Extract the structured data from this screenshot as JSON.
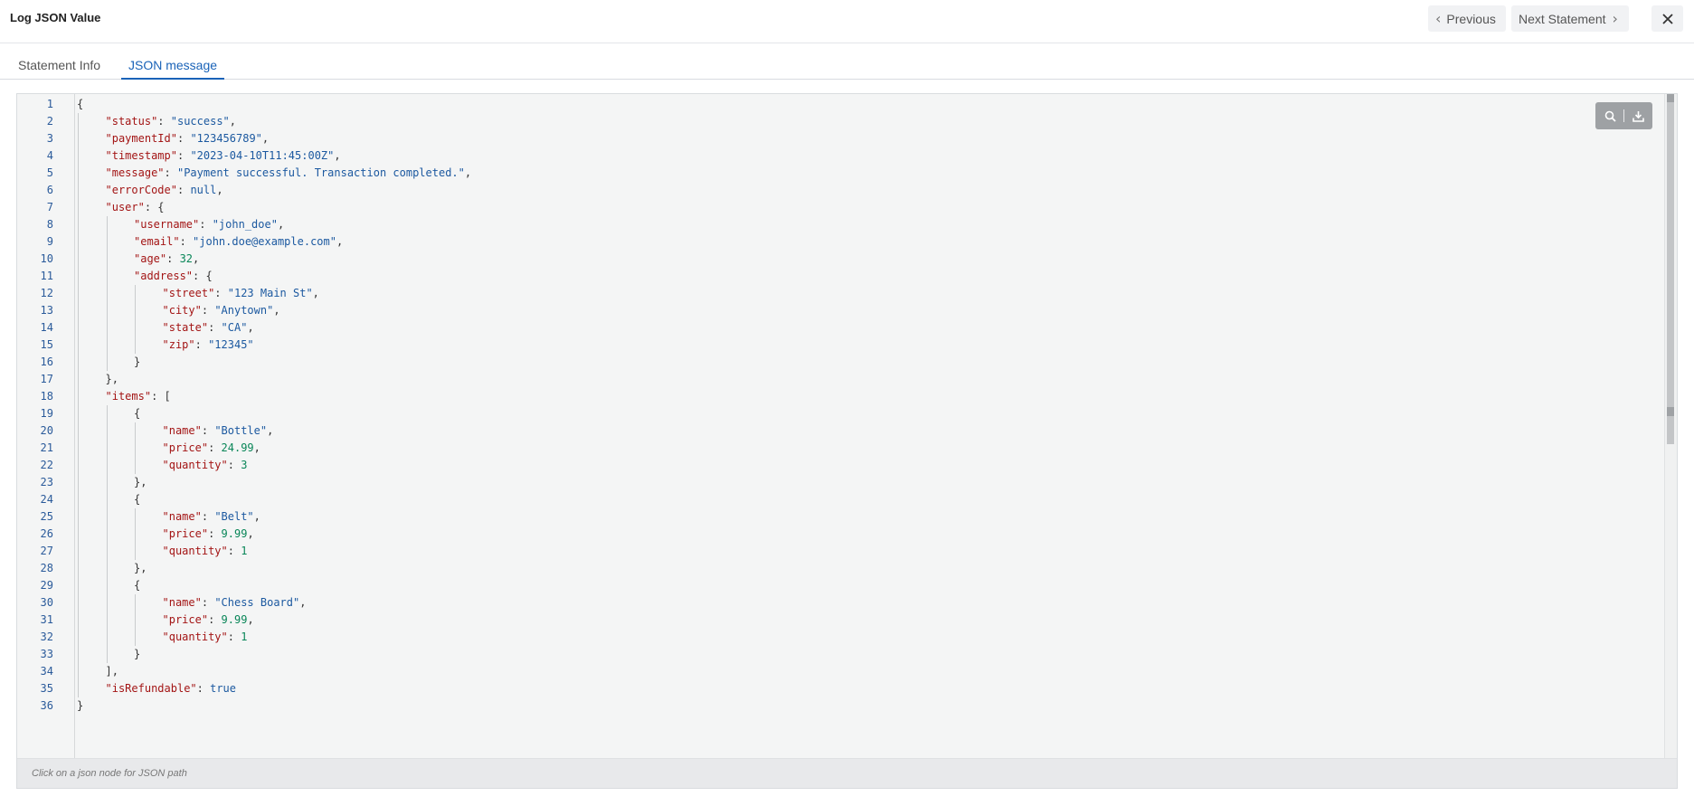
{
  "header": {
    "title": "Log JSON Value",
    "previous_label": "Previous",
    "next_label": "Next Statement"
  },
  "tabs": [
    {
      "label": "Statement Info"
    },
    {
      "label": "JSON message"
    }
  ],
  "editor": {
    "footer_hint": "Click on a json node for JSON path",
    "lines": [
      {
        "n": "1",
        "indent": 0,
        "tokens": [
          [
            "p",
            "{"
          ]
        ]
      },
      {
        "n": "2",
        "indent": 1,
        "tokens": [
          [
            "k",
            "\"status\""
          ],
          [
            "p",
            ": "
          ],
          [
            "s",
            "\"success\""
          ],
          [
            "p",
            ","
          ]
        ]
      },
      {
        "n": "3",
        "indent": 1,
        "tokens": [
          [
            "k",
            "\"paymentId\""
          ],
          [
            "p",
            ": "
          ],
          [
            "s",
            "\"123456789\""
          ],
          [
            "p",
            ","
          ]
        ]
      },
      {
        "n": "4",
        "indent": 1,
        "tokens": [
          [
            "k",
            "\"timestamp\""
          ],
          [
            "p",
            ": "
          ],
          [
            "s",
            "\"2023-04-10T11:45:00Z\""
          ],
          [
            "p",
            ","
          ]
        ]
      },
      {
        "n": "5",
        "indent": 1,
        "tokens": [
          [
            "k",
            "\"message\""
          ],
          [
            "p",
            ": "
          ],
          [
            "s",
            "\"Payment successful. Transaction completed.\""
          ],
          [
            "p",
            ","
          ]
        ]
      },
      {
        "n": "6",
        "indent": 1,
        "tokens": [
          [
            "k",
            "\"errorCode\""
          ],
          [
            "p",
            ": "
          ],
          [
            "kw",
            "null"
          ],
          [
            "p",
            ","
          ]
        ]
      },
      {
        "n": "7",
        "indent": 1,
        "tokens": [
          [
            "k",
            "\"user\""
          ],
          [
            "p",
            ": {"
          ]
        ]
      },
      {
        "n": "8",
        "indent": 2,
        "tokens": [
          [
            "k",
            "\"username\""
          ],
          [
            "p",
            ": "
          ],
          [
            "s",
            "\"john_doe\""
          ],
          [
            "p",
            ","
          ]
        ]
      },
      {
        "n": "9",
        "indent": 2,
        "tokens": [
          [
            "k",
            "\"email\""
          ],
          [
            "p",
            ": "
          ],
          [
            "s",
            "\"john.doe@example.com\""
          ],
          [
            "p",
            ","
          ]
        ]
      },
      {
        "n": "10",
        "indent": 2,
        "tokens": [
          [
            "k",
            "\"age\""
          ],
          [
            "p",
            ": "
          ],
          [
            "n",
            "32"
          ],
          [
            "p",
            ","
          ]
        ]
      },
      {
        "n": "11",
        "indent": 2,
        "tokens": [
          [
            "k",
            "\"address\""
          ],
          [
            "p",
            ": {"
          ]
        ]
      },
      {
        "n": "12",
        "indent": 3,
        "tokens": [
          [
            "k",
            "\"street\""
          ],
          [
            "p",
            ": "
          ],
          [
            "s",
            "\"123 Main St\""
          ],
          [
            "p",
            ","
          ]
        ]
      },
      {
        "n": "13",
        "indent": 3,
        "tokens": [
          [
            "k",
            "\"city\""
          ],
          [
            "p",
            ": "
          ],
          [
            "s",
            "\"Anytown\""
          ],
          [
            "p",
            ","
          ]
        ]
      },
      {
        "n": "14",
        "indent": 3,
        "tokens": [
          [
            "k",
            "\"state\""
          ],
          [
            "p",
            ": "
          ],
          [
            "s",
            "\"CA\""
          ],
          [
            "p",
            ","
          ]
        ]
      },
      {
        "n": "15",
        "indent": 3,
        "tokens": [
          [
            "k",
            "\"zip\""
          ],
          [
            "p",
            ": "
          ],
          [
            "s",
            "\"12345\""
          ]
        ]
      },
      {
        "n": "16",
        "indent": 2,
        "tokens": [
          [
            "p",
            "}"
          ]
        ]
      },
      {
        "n": "17",
        "indent": 1,
        "tokens": [
          [
            "p",
            "},"
          ]
        ]
      },
      {
        "n": "18",
        "indent": 1,
        "tokens": [
          [
            "k",
            "\"items\""
          ],
          [
            "p",
            ": ["
          ]
        ]
      },
      {
        "n": "19",
        "indent": 2,
        "tokens": [
          [
            "p",
            "{"
          ]
        ]
      },
      {
        "n": "20",
        "indent": 3,
        "tokens": [
          [
            "k",
            "\"name\""
          ],
          [
            "p",
            ": "
          ],
          [
            "s",
            "\"Bottle\""
          ],
          [
            "p",
            ","
          ]
        ]
      },
      {
        "n": "21",
        "indent": 3,
        "tokens": [
          [
            "k",
            "\"price\""
          ],
          [
            "p",
            ": "
          ],
          [
            "n",
            "24.99"
          ],
          [
            "p",
            ","
          ]
        ]
      },
      {
        "n": "22",
        "indent": 3,
        "tokens": [
          [
            "k",
            "\"quantity\""
          ],
          [
            "p",
            ": "
          ],
          [
            "n",
            "3"
          ]
        ]
      },
      {
        "n": "23",
        "indent": 2,
        "tokens": [
          [
            "p",
            "},"
          ]
        ]
      },
      {
        "n": "24",
        "indent": 2,
        "tokens": [
          [
            "p",
            "{"
          ]
        ]
      },
      {
        "n": "25",
        "indent": 3,
        "tokens": [
          [
            "k",
            "\"name\""
          ],
          [
            "p",
            ": "
          ],
          [
            "s",
            "\"Belt\""
          ],
          [
            "p",
            ","
          ]
        ]
      },
      {
        "n": "26",
        "indent": 3,
        "tokens": [
          [
            "k",
            "\"price\""
          ],
          [
            "p",
            ": "
          ],
          [
            "n",
            "9.99"
          ],
          [
            "p",
            ","
          ]
        ]
      },
      {
        "n": "27",
        "indent": 3,
        "tokens": [
          [
            "k",
            "\"quantity\""
          ],
          [
            "p",
            ": "
          ],
          [
            "n",
            "1"
          ]
        ]
      },
      {
        "n": "28",
        "indent": 2,
        "tokens": [
          [
            "p",
            "},"
          ]
        ]
      },
      {
        "n": "29",
        "indent": 2,
        "tokens": [
          [
            "p",
            "{"
          ]
        ]
      },
      {
        "n": "30",
        "indent": 3,
        "tokens": [
          [
            "k",
            "\"name\""
          ],
          [
            "p",
            ": "
          ],
          [
            "s",
            "\"Chess Board\""
          ],
          [
            "p",
            ","
          ]
        ]
      },
      {
        "n": "31",
        "indent": 3,
        "tokens": [
          [
            "k",
            "\"price\""
          ],
          [
            "p",
            ": "
          ],
          [
            "n",
            "9.99"
          ],
          [
            "p",
            ","
          ]
        ]
      },
      {
        "n": "32",
        "indent": 3,
        "tokens": [
          [
            "k",
            "\"quantity\""
          ],
          [
            "p",
            ": "
          ],
          [
            "n",
            "1"
          ]
        ]
      },
      {
        "n": "33",
        "indent": 2,
        "tokens": [
          [
            "p",
            "}"
          ]
        ]
      },
      {
        "n": "34",
        "indent": 1,
        "tokens": [
          [
            "p",
            "],"
          ]
        ]
      },
      {
        "n": "35",
        "indent": 1,
        "tokens": [
          [
            "k",
            "\"isRefundable\""
          ],
          [
            "p",
            ": "
          ],
          [
            "kw",
            "true"
          ]
        ]
      },
      {
        "n": "36",
        "indent": 0,
        "tokens": [
          [
            "p",
            "}"
          ]
        ]
      }
    ]
  },
  "icons": {
    "previous": "chevron-left-icon",
    "next": "chevron-right-icon",
    "close": "close-icon",
    "search": "search-icon",
    "download": "download-icon"
  },
  "colors": {
    "accent": "#1a63b8",
    "json_key": "#a31515",
    "json_string": "#1c59a0",
    "json_number": "#098658",
    "editor_bg": "#f4f5f5"
  }
}
